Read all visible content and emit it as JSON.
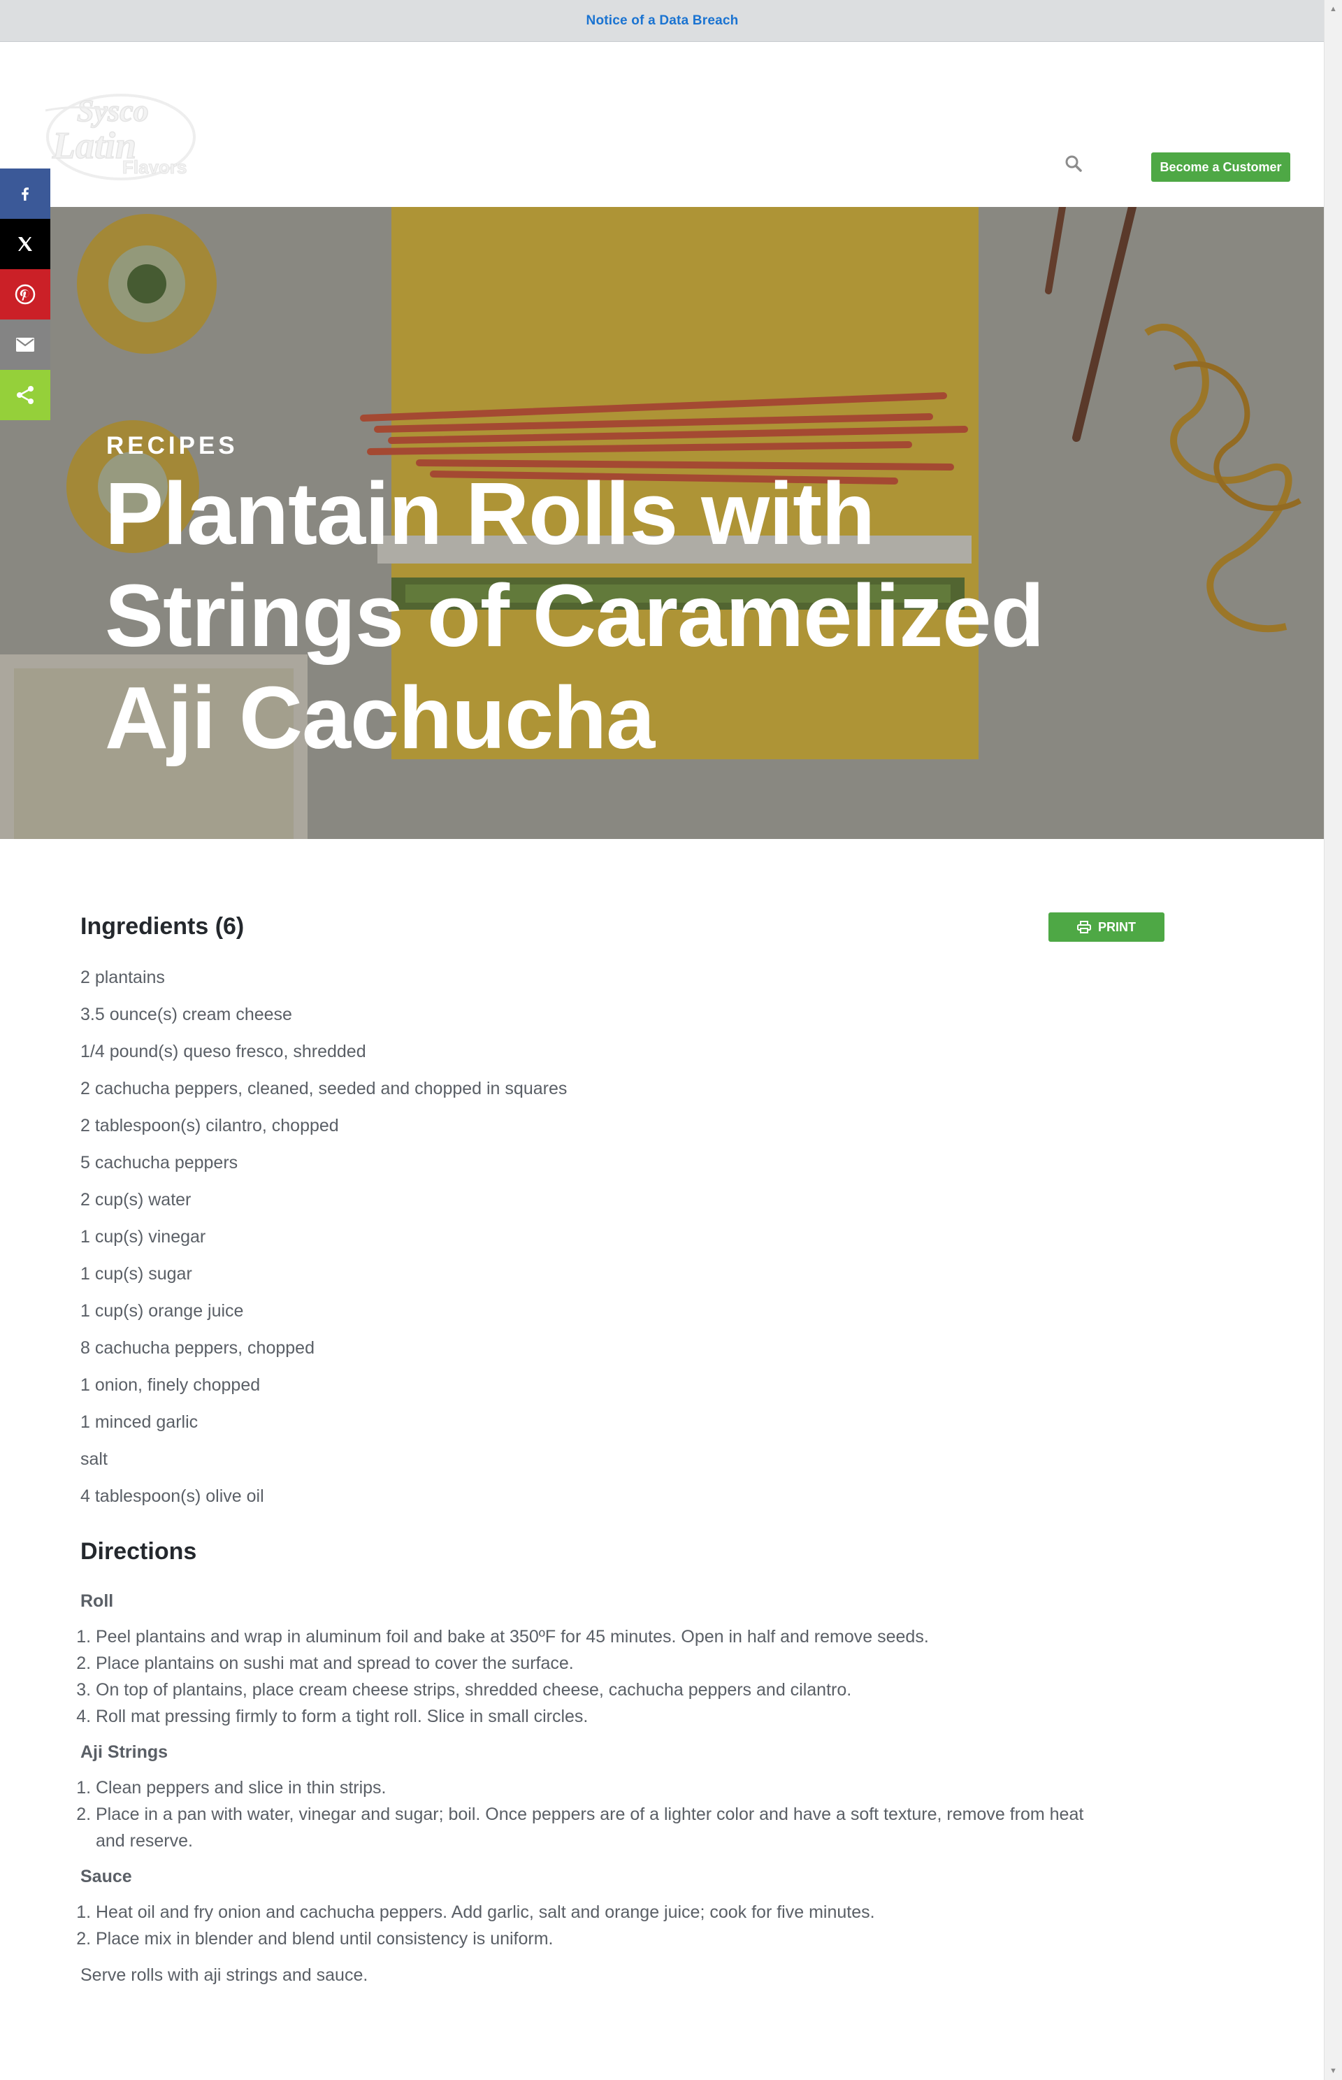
{
  "notice_bar": {
    "link_text": "Notice of a Data Breach"
  },
  "header": {
    "logo_text": "Sysco Latin Flavors",
    "search_icon": "search-icon",
    "cta_label": "Become a Customer"
  },
  "colors": {
    "accent_green": "#4ea845",
    "link_blue": "#1a73d1",
    "facebook": "#3b5998",
    "x": "#000000",
    "pinterest": "#cb2027",
    "email": "#848484",
    "sharethis": "#95d03a"
  },
  "share_bar": {
    "items": [
      {
        "icon": "facebook-icon"
      },
      {
        "icon": "x-icon"
      },
      {
        "icon": "pinterest-icon"
      },
      {
        "icon": "email-icon"
      },
      {
        "icon": "share-icon"
      }
    ]
  },
  "hero": {
    "eyebrow": "RECIPES",
    "title_lines": [
      "Plantain Rolls with",
      "Strings of Caramelized",
      "Aji Cachucha"
    ]
  },
  "ingredients": {
    "heading": "Ingredients (6)",
    "print_label": "PRINT",
    "items": [
      "2 plantains",
      "3.5 ounce(s) cream cheese",
      "1/4 pound(s) queso fresco, shredded",
      "2 cachucha peppers, cleaned, seeded and chopped in squares",
      "2 tablespoon(s) cilantro, chopped",
      "5 cachucha peppers",
      "2 cup(s) water",
      "1 cup(s) vinegar",
      "1 cup(s) sugar",
      "1 cup(s) orange juice",
      "8 cachucha peppers, chopped",
      "1 onion, finely chopped",
      "1 minced garlic",
      "salt",
      "4 tablespoon(s) olive oil"
    ]
  },
  "directions": {
    "heading": "Directions",
    "sections": [
      {
        "title": "Roll",
        "steps": [
          "Peel plantains and wrap in aluminum foil and bake at 350ºF for 45 minutes. Open in half and remove seeds.",
          "Place plantains on sushi mat and spread to cover the surface.",
          "On top of plantains, place cream cheese strips, shredded cheese, cachucha peppers and cilantro.",
          "Roll mat pressing firmly to form a tight roll. Slice in small circles."
        ]
      },
      {
        "title": "Aji Strings",
        "steps": [
          "Clean peppers and slice in thin strips.",
          "Place in a pan with water, vinegar and sugar; boil. Once peppers are of a lighter color and have a soft texture, remove from heat and reserve."
        ]
      },
      {
        "title": "Sauce",
        "steps": [
          "Heat oil and fry onion and cachucha peppers. Add garlic, salt and orange juice; cook for five minutes.",
          "Place mix in blender and blend until consistency is uniform."
        ]
      }
    ],
    "serve_note": "Serve rolls with aji strings and sauce."
  }
}
